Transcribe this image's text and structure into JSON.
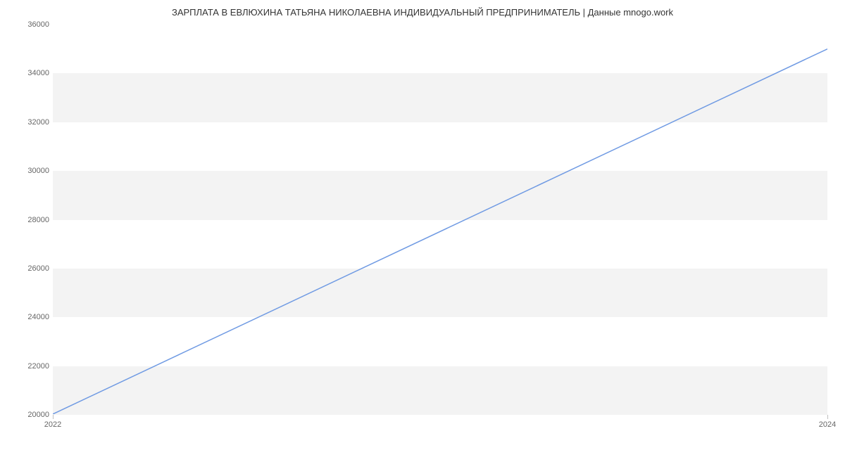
{
  "chart_data": {
    "type": "line",
    "title": "ЗАРПЛАТА В ЕВЛЮХИНА ТАТЬЯНА НИКОЛАЕВНА ИНДИВИДУАЛЬНЫЙ ПРЕДПРИНИМАТЕЛЬ | Данные mnogo.work",
    "x": [
      2022,
      2024
    ],
    "values": [
      20000,
      35000
    ],
    "xlabel": "",
    "ylabel": "",
    "xlim": [
      2022,
      2024
    ],
    "ylim": [
      20000,
      36000
    ],
    "x_ticks": [
      2022,
      2024
    ],
    "y_ticks": [
      20000,
      22000,
      24000,
      26000,
      28000,
      30000,
      32000,
      34000,
      36000
    ],
    "line_color": "#6f9ae3"
  }
}
